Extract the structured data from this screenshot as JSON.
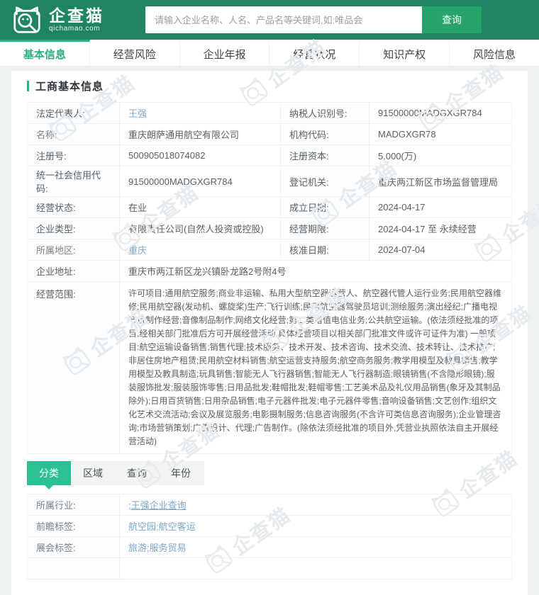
{
  "colors": {
    "header_green": "#1e8463",
    "button_green": "#27a36b",
    "accent_green": "#25b284",
    "filter_tab_green": "#2cc194",
    "label_blue": "#a6c3d9",
    "link_blue": "#7ca6c9"
  },
  "header": {
    "logo_title": "企查猫",
    "logo_domain": "qichamao.com",
    "logo_icon": "cat-magnifier-icon",
    "search_placeholder": "请输入企业名称、人名、产品名等关键词,如:唯品会",
    "search_button": "查询"
  },
  "nav": {
    "tabs": [
      {
        "label": "基本信息",
        "active": true
      },
      {
        "label": "经营风险",
        "active": false
      },
      {
        "label": "企业年报",
        "active": false
      },
      {
        "label": "经营状况",
        "active": false
      },
      {
        "label": "知识产权",
        "active": false
      },
      {
        "label": "风险信息",
        "active": false
      }
    ]
  },
  "watermark": {
    "text": "企查猫"
  },
  "business_info": {
    "section_title": "工商基本信息",
    "rows": [
      {
        "label1": "法定代表人:",
        "value1": "王强",
        "label2": "纳税人识别号:",
        "value2": "91500000MADGXGR784"
      },
      {
        "label1": "名称:",
        "value1": "重庆朗萨通用航空有限公司",
        "label2": "机构代码:",
        "value2": "MADGXGR78"
      },
      {
        "label1": "注册号:",
        "value1": "500905018074082",
        "label2": "注册资本:",
        "value2": "5,000(万)"
      },
      {
        "label1": "统一社会信用代码:",
        "value1": "91500000MADGXGR784",
        "label2": "登记机关:",
        "value2": "重庆两江新区市场监督管理局"
      },
      {
        "label1": "经营状态:",
        "value1": "在业",
        "label2": "成立日期:",
        "value2": "2024-04-17"
      },
      {
        "label1": "企业类型:",
        "value1": "有限责任公司(自然人投资或控股)",
        "label2": "经营期限:",
        "value2": "2024-04-17 至 永续经营"
      },
      {
        "label1": "所属地区:",
        "value1": "重庆",
        "label2": "核准日期:",
        "value2": "2024-07-04"
      }
    ],
    "address_row": {
      "label": "企业地址:",
      "value": "重庆市两江新区龙兴镇卧龙路2号附4号"
    },
    "scope_row": {
      "label": "经营范围:",
      "value": "许可项目:通用航空服务;商业非运输、私用大型航空器运营人、航空器代管人运行业务;民用航空器维修;民用航空器(发动机、螺旋桨)生产;飞行训练;民用航空器驾驶员培训;测绘服务;演出经纪;广播电视节目制作经营;音像制品制作;网络文化经营;第二类增值电信业务;公共航空运输。(依法须经批准的项目,经相关部门批准后方可开展经营活动,具体经营项目以相关部门批准文件或许可证件为准) 一般项目:航空运输设备销售;销售代理;技术服务、技术开发、技术咨询、技术交流、技术转让、技术推广;非居住房地产租赁;民用航空材料销售;航空运营支持服务;航空商务服务;教学用模型及教具销售;教学用模型及教具制造;玩具销售;智能无人飞行器销售;智能无人飞行器制造;眼镜销售(不含隐形眼镜);服装服饰批发;服装服饰零售;日用品批发;鞋帽批发;鞋帽零售;工艺美术品及礼仪用品销售(象牙及其制品除外);日用百货销售;日用杂品销售;电子元器件批发;电子元器件零售;音响设备销售;文艺创作;组织文化艺术交流活动;会议及展览服务;电影摄制服务;信息咨询服务(不含许可类信息咨询服务);企业管理咨询;市场营销策划;广告设计、代理;广告制作。(除依法须经批准的项目外,凭营业执照依法自主开展经营活动)"
    }
  },
  "filter_tabs": {
    "items": [
      {
        "label": "分类",
        "active": true
      },
      {
        "label": "区域",
        "active": false
      },
      {
        "label": "查询",
        "active": false
      },
      {
        "label": "年份",
        "active": false
      }
    ]
  },
  "tags": {
    "separator": ";",
    "rows": [
      {
        "label": "所属行业:",
        "links": [
          ";王强企业查询"
        ]
      },
      {
        "label": "前瞻标签:",
        "links": [
          "航空园",
          "航空客运"
        ]
      },
      {
        "label": "展会标签:",
        "links": [
          "旅游",
          "服务贸易"
        ]
      }
    ]
  }
}
